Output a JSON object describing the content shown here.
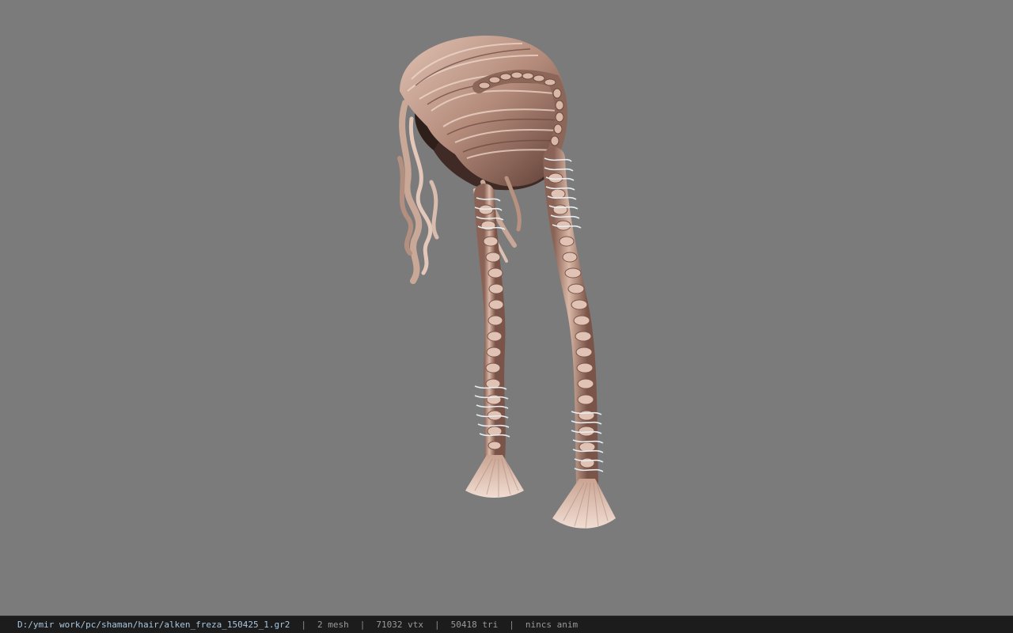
{
  "viewport": {
    "background": "#7b7b7b",
    "model": "hair-model"
  },
  "statusbar": {
    "file_path": "D:/ymir work/pc/shaman/hair/alken_freza_150425_1.gr2",
    "separator": "|",
    "mesh": "2 mesh",
    "vertices": "71032 vtx",
    "triangles": "50418 tri",
    "anim": "nincs anim"
  },
  "colors": {
    "hair_light": "#d8b8a8",
    "hair_mid": "#b08878",
    "hair_dark": "#6e4a40",
    "wire": "#dfe6ea"
  }
}
